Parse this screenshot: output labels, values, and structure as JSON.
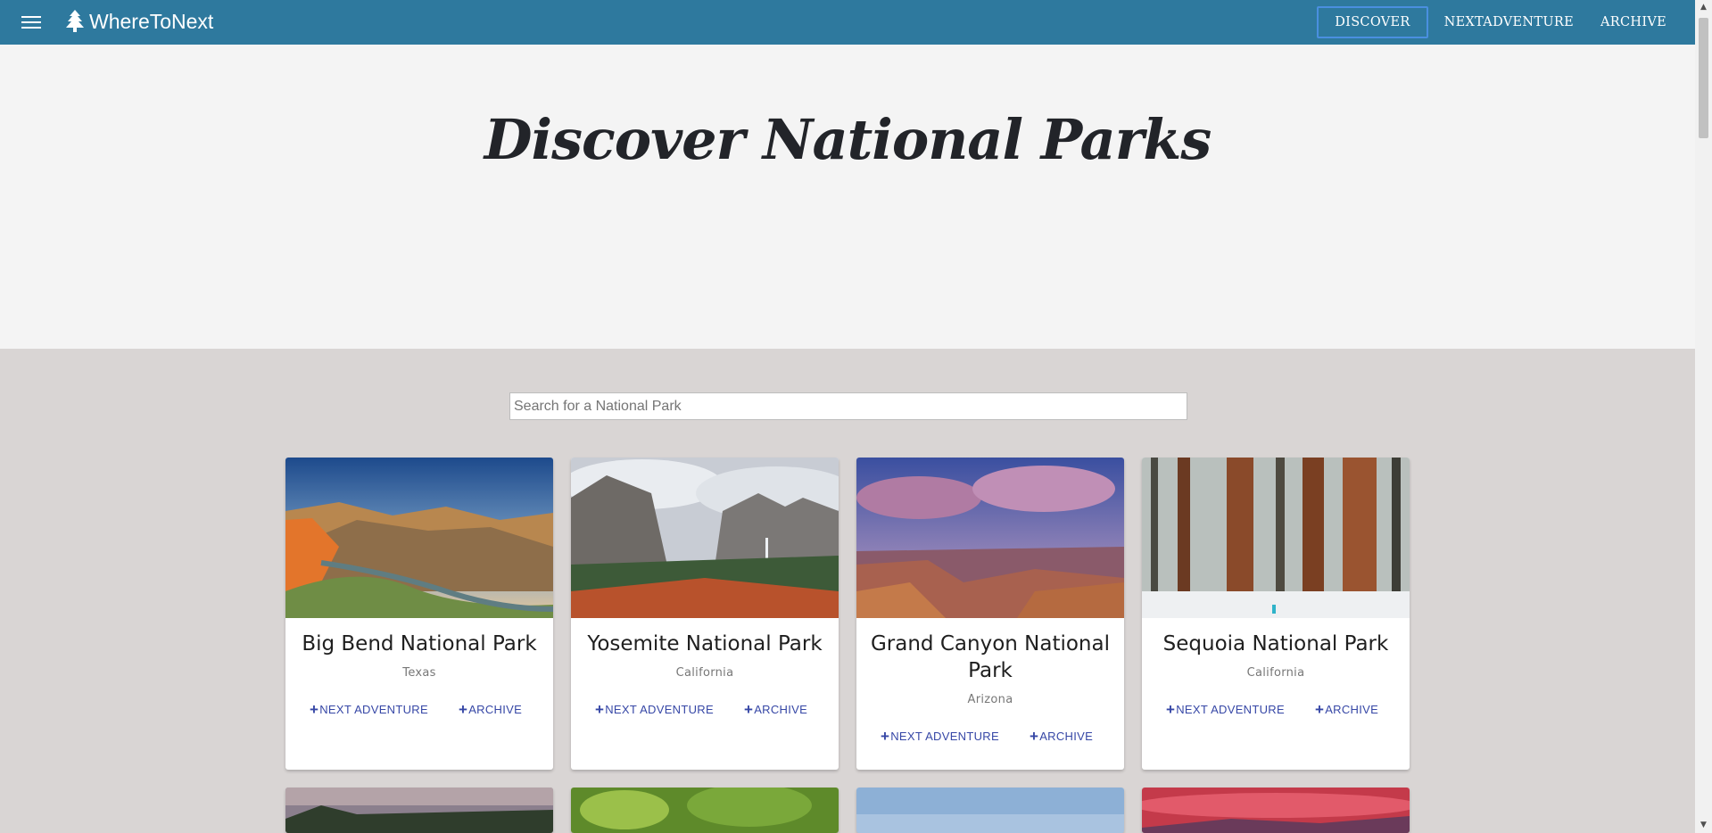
{
  "brand": {
    "name": "WhereToNext",
    "icon": "tree-icon"
  },
  "nav": {
    "discover": "DISCOVER",
    "next_adventure": "NEXTADVENTURE",
    "archive": "ARCHIVE"
  },
  "hero": {
    "title": "Discover National Parks"
  },
  "search": {
    "placeholder": "Search for a National Park"
  },
  "card_actions": {
    "next_adventure": "NEXT ADVENTURE",
    "archive": "ARCHIVE"
  },
  "parks": [
    {
      "name": "Big Bend National Park",
      "state": "Texas"
    },
    {
      "name": "Yosemite National Park",
      "state": "California"
    },
    {
      "name": "Grand Canyon National Park",
      "state": "Arizona"
    },
    {
      "name": "Sequoia National Park",
      "state": "California"
    }
  ],
  "colors": {
    "navbar": "#2e799e",
    "hero_bg": "#f4f4f4",
    "page_bg": "#d9d5d4",
    "action": "#3647a6"
  }
}
